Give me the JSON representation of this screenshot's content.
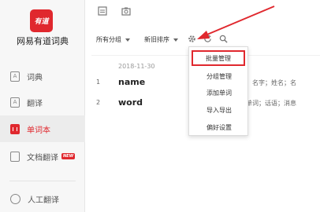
{
  "app": {
    "logo_text": "有道",
    "title": "网易有道词典"
  },
  "sidebar": {
    "items": [
      {
        "label": "词典"
      },
      {
        "label": "翻译"
      },
      {
        "label": "单词本"
      },
      {
        "label": "文档翻译",
        "badge": "NEW"
      },
      {
        "label": "人工翻译"
      }
    ]
  },
  "toolbar": {
    "group_filter": "所有分组",
    "sort": "新旧排序"
  },
  "wordlist": {
    "date": "2018-11-30",
    "rows": [
      {
        "num": "1",
        "word": "name",
        "def": "，名字；姓名；名"
      },
      {
        "num": "2",
        "word": "word",
        "def": "单词；话语；消息"
      }
    ]
  },
  "menu": {
    "items": [
      "批量管理",
      "分组管理",
      "添加单词",
      "导入导出",
      "偏好设置"
    ],
    "highlighted": "批量管理"
  },
  "colors": {
    "accent": "#e0282e"
  }
}
